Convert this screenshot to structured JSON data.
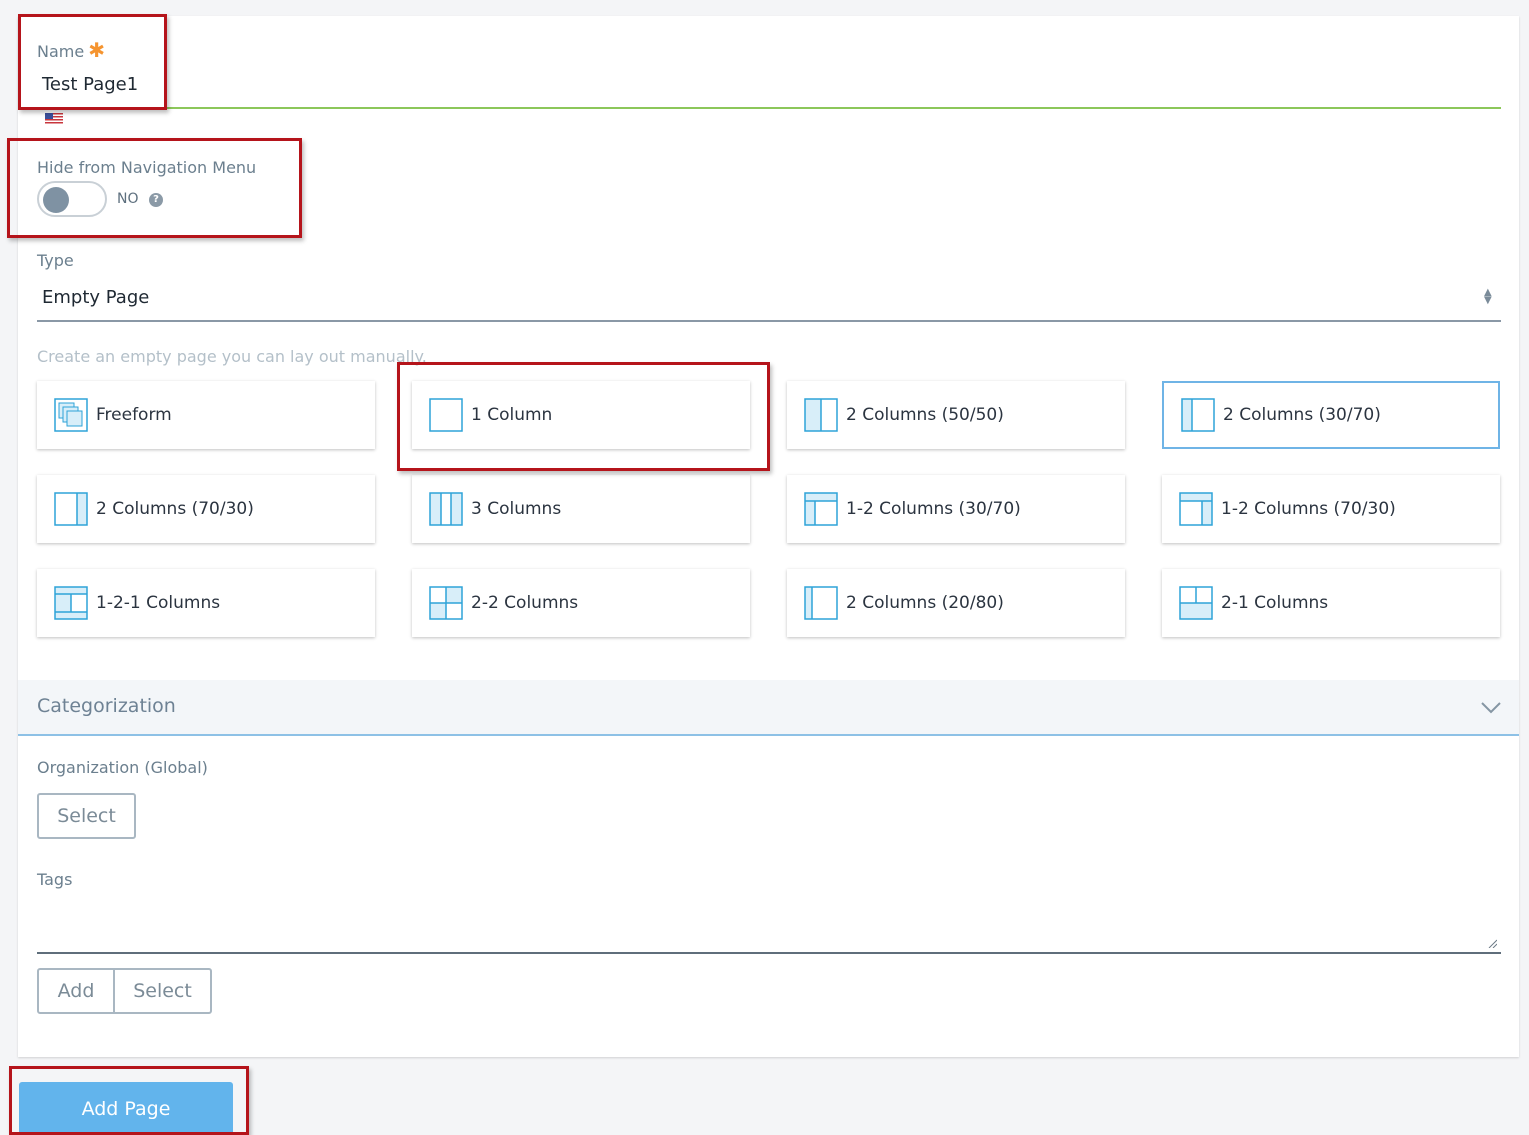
{
  "name_field": {
    "label": "Name",
    "required_mark": "✱",
    "value": "Test Page1"
  },
  "hide_nav": {
    "label": "Hide from Navigation Menu",
    "state": "NO",
    "help": "?"
  },
  "type_field": {
    "label": "Type",
    "value": "Empty Page",
    "hint": "Create an empty page you can lay out manually."
  },
  "layouts": [
    {
      "label": "Freeform",
      "icon": "freeform-layout-icon"
    },
    {
      "label": "1 Column",
      "icon": "one-column-layout-icon"
    },
    {
      "label": "2 Columns (50/50)",
      "icon": "two-columns-50-50-layout-icon"
    },
    {
      "label": "2 Columns (30/70)",
      "icon": "two-columns-30-70-layout-icon",
      "selected": true
    },
    {
      "label": "2 Columns (70/30)",
      "icon": "two-columns-70-30-layout-icon"
    },
    {
      "label": "3 Columns",
      "icon": "three-columns-layout-icon"
    },
    {
      "label": "1-2 Columns (30/70)",
      "icon": "one-two-columns-30-70-layout-icon"
    },
    {
      "label": "1-2 Columns (70/30)",
      "icon": "one-two-columns-70-30-layout-icon"
    },
    {
      "label": "1-2-1 Columns",
      "icon": "one-two-one-columns-layout-icon"
    },
    {
      "label": "2-2 Columns",
      "icon": "two-two-columns-layout-icon"
    },
    {
      "label": "2 Columns (20/80)",
      "icon": "two-columns-20-80-layout-icon"
    },
    {
      "label": "2-1 Columns",
      "icon": "two-one-columns-layout-icon"
    }
  ],
  "categorization": {
    "title": "Categorization",
    "organization_label": "Organization (Global)",
    "select_label": "Select",
    "tags_label": "Tags",
    "add_label": "Add",
    "tags_select_label": "Select"
  },
  "add_page_label": "Add Page",
  "colors": {
    "accent": "#62b4ec",
    "highlight": "#b5141b",
    "required": "#f5942f",
    "valid_line": "#8cc75a"
  }
}
